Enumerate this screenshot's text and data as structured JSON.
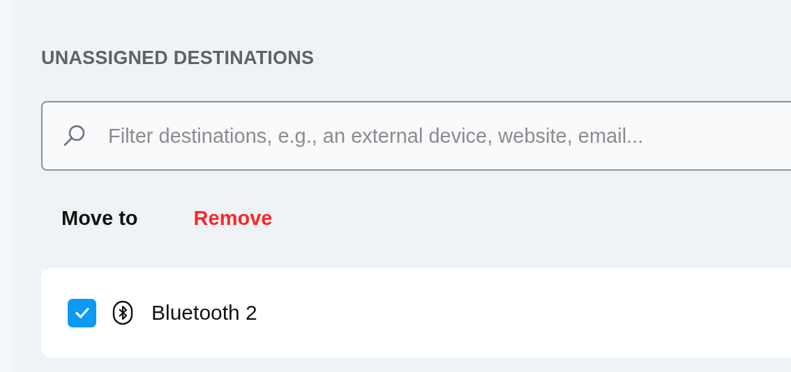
{
  "section": {
    "title": "UNASSIGNED DESTINATIONS"
  },
  "search": {
    "placeholder": "Filter destinations, e.g., an external device, website, email..."
  },
  "actions": [
    {
      "label": "Move to",
      "kind": "neutral"
    },
    {
      "label": "Remove",
      "kind": "danger"
    }
  ],
  "destinations": [
    {
      "name": "Bluetooth 2",
      "kind": "bluetooth",
      "checked": true
    }
  ]
}
